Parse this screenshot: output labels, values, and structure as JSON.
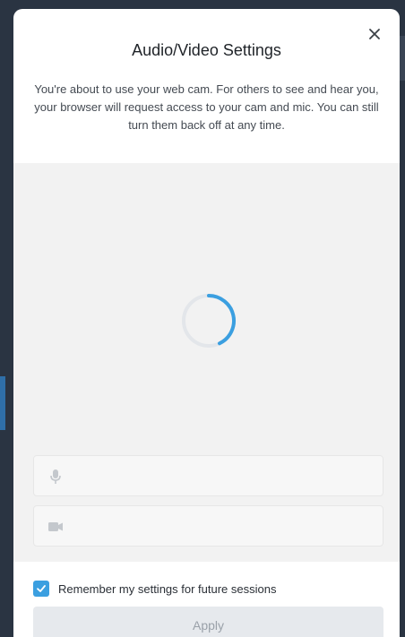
{
  "dialog": {
    "title": "Audio/Video Settings",
    "close_icon": "close-icon",
    "description": "You're about to use your web cam. For others to see and hear you, your browser will request access to your cam and mic. You can still turn them back off at any time."
  },
  "preview": {
    "state": "loading",
    "spinner_icon": "loading-spinner-icon",
    "accent_color": "#3b9fe0"
  },
  "devices": {
    "microphone": {
      "icon": "microphone-icon",
      "value": ""
    },
    "camera": {
      "icon": "camera-icon",
      "value": ""
    }
  },
  "footer": {
    "remember_checked": true,
    "remember_label": "Remember my settings for future sessions",
    "apply_label": "Apply",
    "apply_enabled": false
  }
}
